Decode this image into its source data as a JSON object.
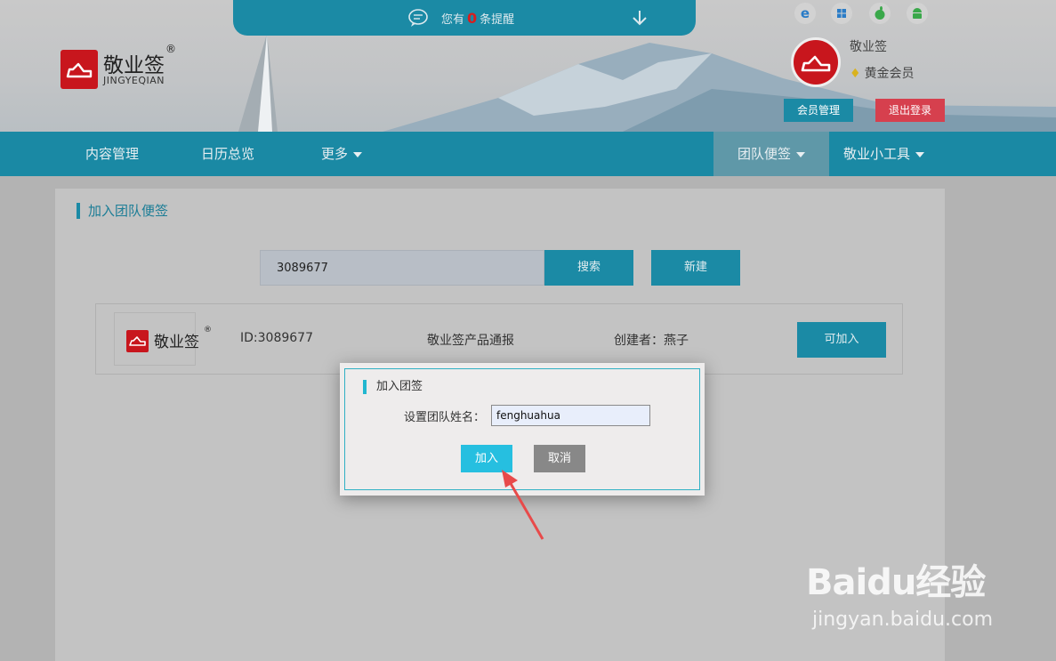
{
  "header": {
    "notice": {
      "prefix": "您有",
      "count": "0",
      "suffix": "条提醒"
    },
    "logo": {
      "cn": "敬业签",
      "en": "JINGYEQIAN",
      "reg": "®"
    },
    "platform_icons": [
      "ie-icon",
      "windows-icon",
      "apple-icon",
      "android-icon"
    ],
    "user": {
      "name": "敬业签",
      "level": "黄金会员"
    },
    "member_btn": "会员管理",
    "logout_btn": "退出登录"
  },
  "nav": {
    "items": [
      {
        "label": "内容管理"
      },
      {
        "label": "日历总览"
      },
      {
        "label": "更多"
      },
      {
        "label": "团队便签"
      },
      {
        "label": "敬业小工具"
      }
    ]
  },
  "panel": {
    "title": "加入团队便签",
    "search": {
      "value": "3089677"
    },
    "search_btn": "搜索",
    "new_btn": "新建",
    "result": {
      "logo_text": "敬业签",
      "logo_reg": "®",
      "id": "ID:3089677",
      "name": "敬业签产品通报",
      "creator": "创建者：燕子",
      "join_btn": "可加入"
    }
  },
  "modal": {
    "title": "加入团签",
    "label": "设置团队姓名：",
    "input_value": "fenghuahua",
    "join_btn": "加入",
    "cancel_btn": "取消"
  },
  "watermark": {
    "main": "Baidu经验",
    "sub": "jingyan.baidu.com"
  },
  "colors": {
    "primary": "#1a89a4",
    "logo_red": "#c8161d",
    "logout": "#d6404e",
    "join": "#26bfe0",
    "pointer": "#e84a4a"
  }
}
